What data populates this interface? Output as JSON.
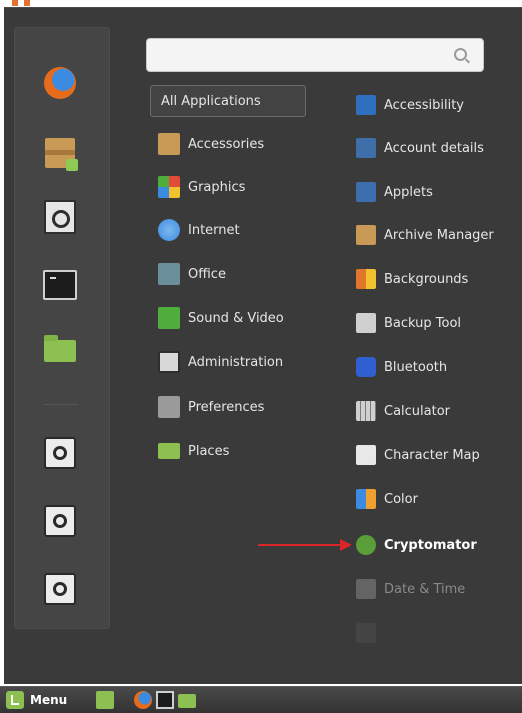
{
  "search": {
    "placeholder": "",
    "value": ""
  },
  "favorites": [
    {
      "name": "firefox-icon"
    },
    {
      "name": "archive-manager-icon"
    },
    {
      "name": "system-settings-icon"
    },
    {
      "name": "terminal-icon"
    },
    {
      "name": "files-folder-icon"
    },
    {
      "name": "lock-screen-icon"
    },
    {
      "name": "logout-icon"
    },
    {
      "name": "shutdown-icon"
    }
  ],
  "categories": [
    {
      "label": "All Applications",
      "selected": true
    },
    {
      "label": "Accessories",
      "icon": "accessories-icon",
      "color": "#c89a56"
    },
    {
      "label": "Graphics",
      "icon": "graphics-icon",
      "color": "#e04b3a"
    },
    {
      "label": "Internet",
      "icon": "internet-icon",
      "color": "#3b8be0"
    },
    {
      "label": "Office",
      "icon": "office-icon",
      "color": "#6a8f9a"
    },
    {
      "label": "Sound & Video",
      "icon": "sound-video-icon",
      "color": "#4fae3b"
    },
    {
      "label": "Administration",
      "icon": "administration-icon",
      "color": "#d8d8d8"
    },
    {
      "label": "Preferences",
      "icon": "preferences-icon",
      "color": "#9a9a9a"
    },
    {
      "label": "Places",
      "icon": "places-icon",
      "color": "#8cc152"
    }
  ],
  "applications": [
    {
      "label": "Accessibility",
      "icon": "accessibility-icon",
      "color": "#2f6fbf"
    },
    {
      "label": "Account details",
      "icon": "account-details-icon",
      "color": "#3f6fa8"
    },
    {
      "label": "Applets",
      "icon": "applets-icon",
      "color": "#3b6fb0"
    },
    {
      "label": "Archive Manager",
      "icon": "archive-manager-icon",
      "color": "#c89a56"
    },
    {
      "label": "Backgrounds",
      "icon": "backgrounds-icon",
      "color": "#e0752c"
    },
    {
      "label": "Backup Tool",
      "icon": "backup-tool-icon",
      "color": "#d0d0d0"
    },
    {
      "label": "Bluetooth",
      "icon": "bluetooth-icon",
      "color": "#2f5fd0"
    },
    {
      "label": "Calculator",
      "icon": "calculator-icon",
      "color": "#cfcfcf"
    },
    {
      "label": "Character Map",
      "icon": "character-map-icon",
      "color": "#e8e8e8"
    },
    {
      "label": "Color",
      "icon": "color-icon",
      "color": "#f0a030"
    },
    {
      "label": "Cryptomator",
      "icon": "cryptomator-icon",
      "color": "#5a9e3a",
      "highlight": true
    },
    {
      "label": "Date & Time",
      "icon": "date-time-icon",
      "color": "#9a9a9a",
      "faded": true
    }
  ],
  "taskbar": {
    "menu_label": "Menu"
  },
  "colors": {
    "panel_bg": "#3a3a3a",
    "favorites_bg": "#454545",
    "accent": "#8cc152",
    "annotation_arrow": "#d9262a"
  }
}
